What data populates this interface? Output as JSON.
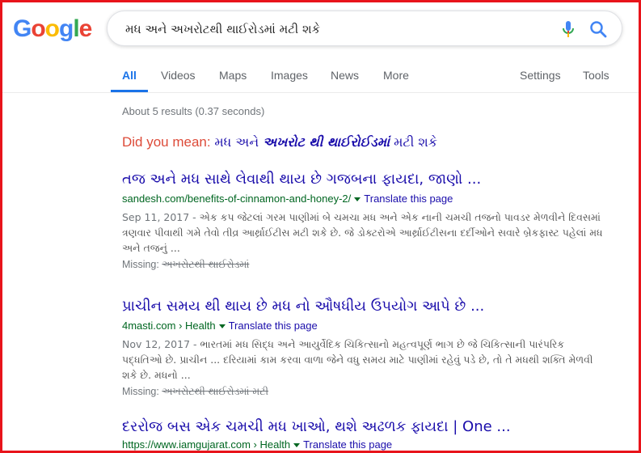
{
  "search": {
    "query": "મધ અને અખરોટથી થાઈરોડમાં મટી શકે"
  },
  "tabs": [
    {
      "label": "All"
    },
    {
      "label": "Videos"
    },
    {
      "label": "Maps"
    },
    {
      "label": "Images"
    },
    {
      "label": "News"
    },
    {
      "label": "More"
    }
  ],
  "tools": {
    "settings": "Settings",
    "tools": "Tools"
  },
  "stats": "About 5 results (0.37 seconds)",
  "did_you_mean": {
    "label": "Did you mean:",
    "pre": "મધ અને",
    "bold": "અખરોટ થી થાઈરોઈડમાં",
    "post": "મટી શકે"
  },
  "results": [
    {
      "title": "તજ અને મધ સાથે લેવાથી થાય છે ગજબના ફાયદા, જાણો ...",
      "url": "sandesh.com/benefits-of-cinnamon-and-honey-2/",
      "translate": "Translate this page",
      "date": "Sep 11, 2017 - ",
      "snippet": "એક કપ જેટલાં ગરમ પાણીમાં બે ચમચા મધ અને એક નાની ચમચી તજનો પાવડર મેળવીને દિવસમાં ત્રણવાર પીવાથી ગમે તેવો તીવ્ર આર્થ્રાઈટીસ મટી શકે છે. જે ડોક્ટરોએ આર્થ્રાઈટીસના દર્દીઓને સવારે બ્રેકફાસ્ટ પહેલાં મધ અને તજનું ...",
      "missing_label": "Missing:",
      "missing": "અખરોટથી થાઈરોડમાં"
    },
    {
      "title": "પ્રાચીન સમય થી થાય છે મધ નો ઔષધીય ઉપયોગ આપે છે ...",
      "url": "4masti.com › Health",
      "translate": "Translate this page",
      "date": "Nov 12, 2017 - ",
      "snippet": "ભારતમાં મધ સિદ્ધ અને આયુર્વેદિક ચિકિત્સાનો મહત્વપૂર્ણ ભાગ છે જે ચિકિત્સાની પારંપરિક પદ્ધતિઓ છે. પ્રાચીન ... દરિયામાં કામ કરવા વાળા જેને વધુ સમય માટે પાણીમાં રહેવું પડે છે, તો તે મધથી શક્તિ મેળવી શકે છે. મધનો ...",
      "missing_label": "Missing:",
      "missing": "અખરોટથી થાઈરોડમાં મટી"
    },
    {
      "title": "દરરોજ બસ એક ચમચી મધ ખાઓ, થશે અઢળક ફાયદા | One ...",
      "url": "https://www.iamgujarat.com › Health",
      "translate": "Translate this page"
    }
  ]
}
